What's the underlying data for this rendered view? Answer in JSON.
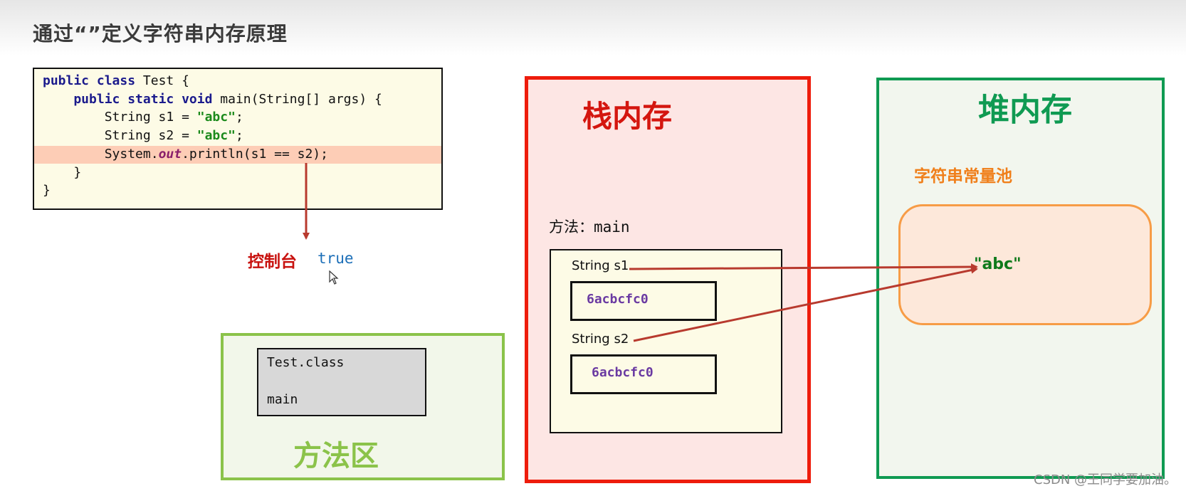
{
  "page": {
    "title": "通过“”定义字符串内存原理",
    "watermark": "CSDN @王同学要加油。"
  },
  "code": {
    "lines": [
      {
        "parts": [
          {
            "t": "public ",
            "c": "kw"
          },
          {
            "t": "class ",
            "c": "kw"
          },
          {
            "t": "Test {",
            "c": ""
          }
        ]
      },
      {
        "parts": [
          {
            "t": "    public ",
            "c": "kw"
          },
          {
            "t": "static ",
            "c": "kw"
          },
          {
            "t": "void ",
            "c": "kw"
          },
          {
            "t": "main(String[] args) {",
            "c": ""
          }
        ]
      },
      {
        "parts": [
          {
            "t": "        String s1 = ",
            "c": ""
          },
          {
            "t": "\"abc\"",
            "c": "str"
          },
          {
            "t": ";",
            "c": ""
          }
        ]
      },
      {
        "parts": [
          {
            "t": "        String s2 = ",
            "c": ""
          },
          {
            "t": "\"abc\"",
            "c": "str"
          },
          {
            "t": ";",
            "c": ""
          }
        ]
      },
      {
        "parts": [
          {
            "t": "        System.",
            "c": ""
          },
          {
            "t": "out",
            "c": "fld"
          },
          {
            "t": ".println(s1 == s2);",
            "c": ""
          }
        ]
      },
      {
        "parts": [
          {
            "t": "    }",
            "c": ""
          }
        ]
      },
      {
        "parts": [
          {
            "t": "}",
            "c": ""
          }
        ]
      }
    ],
    "highlighted_line": 5
  },
  "console": {
    "label": "控制台",
    "value": "true"
  },
  "method_area": {
    "title": "方法区",
    "class_name": "Test.class",
    "method": "main"
  },
  "stack": {
    "title": "栈内存",
    "method_label": "方法：main",
    "variables": [
      {
        "label": "String s1",
        "address": "6acbcfc0"
      },
      {
        "label": "String s2",
        "address": "6acbcfc0"
      }
    ]
  },
  "heap": {
    "title": "堆内存",
    "pool_title": "字符串常量池",
    "pool_value": "\"abc\""
  },
  "colors": {
    "stack": "#ee1c0c",
    "heap": "#0f9a52",
    "method_area": "#8bc34a",
    "pool": "#f79c46",
    "arrow": "#b83a2e",
    "address": "#6a3aa2"
  }
}
